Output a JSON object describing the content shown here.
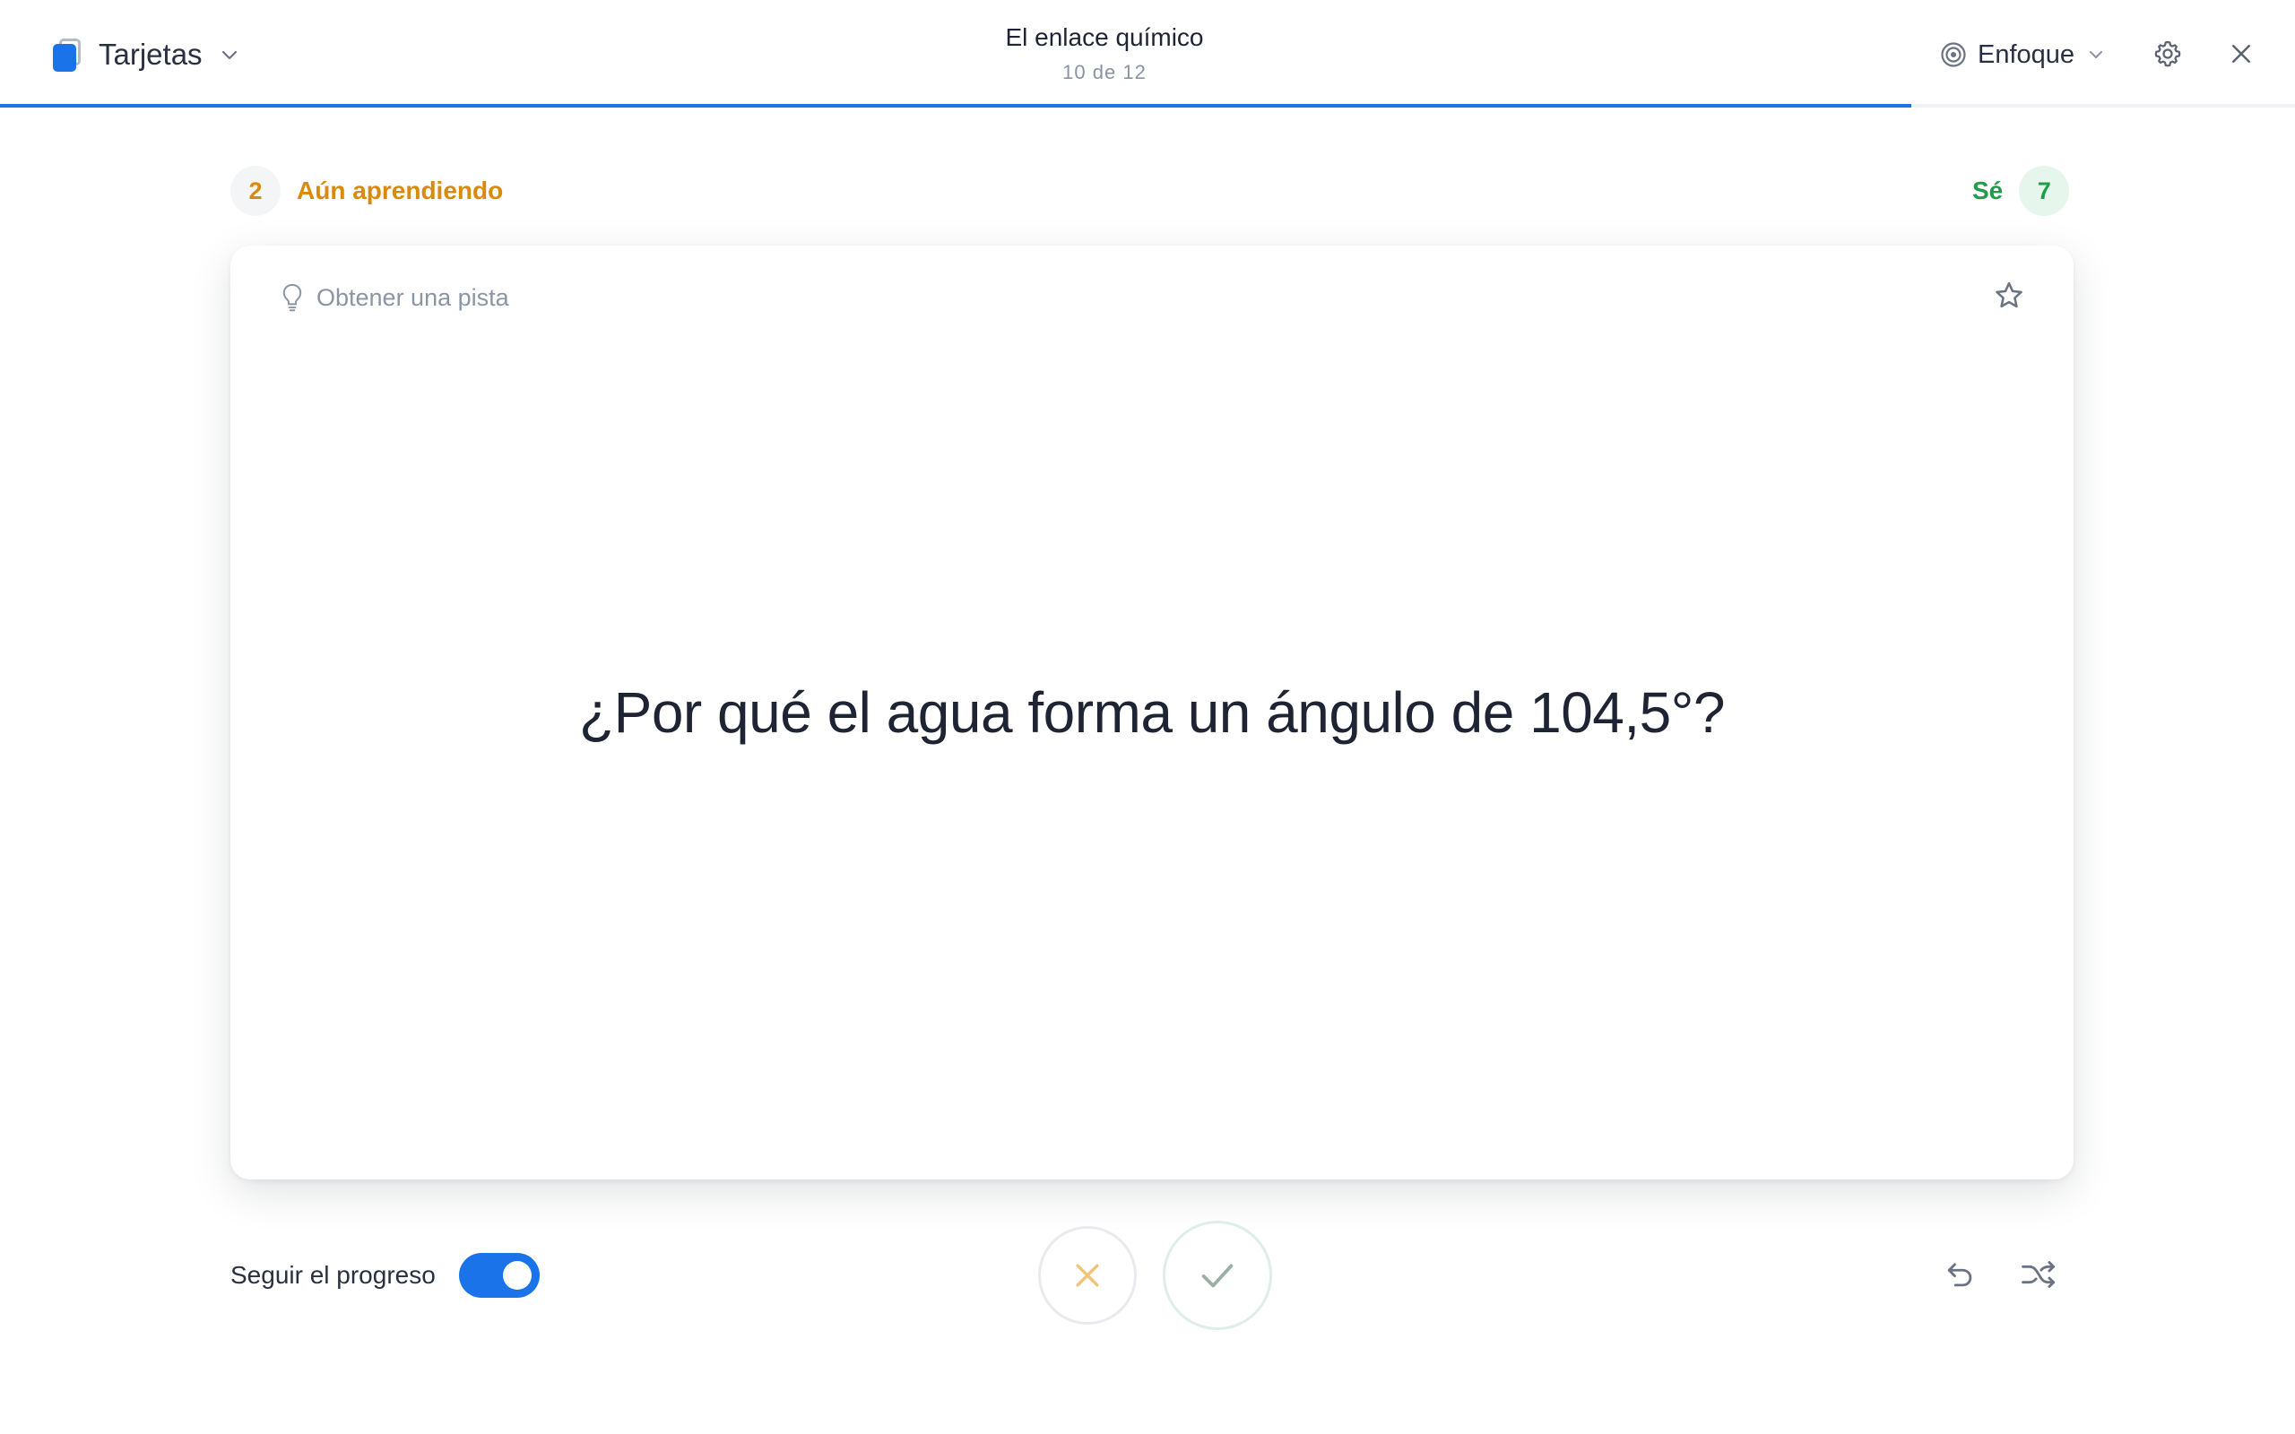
{
  "header": {
    "mode_label": "Tarjetas",
    "mode_icon": "cards-icon",
    "deck_title": "El enlace químico",
    "deck_count": "10 de 12",
    "focus_label": "Enfoque",
    "focus_icon": "target-icon",
    "settings_icon": "gear-icon",
    "close_icon": "close-icon",
    "accent_color": "#1a73e8",
    "progress": 0.833
  },
  "stats": {
    "learning_count": "2",
    "learning_label": "Aún aprendiendo",
    "learning_color": "#d98a0d",
    "known_label": "Sé",
    "known_count": "7",
    "known_color": "#1f9d4a"
  },
  "card": {
    "hint_label": "Obtener una pista",
    "hint_icon": "lightbulb-icon",
    "star_icon": "star-icon",
    "question": "¿Por qué el agua forma un ángulo de 104,5°?"
  },
  "footer": {
    "track_progress_label": "Seguir el progreso",
    "track_progress_on": true,
    "wrong_icon": "x-icon",
    "right_icon": "check-icon",
    "undo_icon": "undo-icon",
    "shuffle_icon": "shuffle-icon"
  }
}
